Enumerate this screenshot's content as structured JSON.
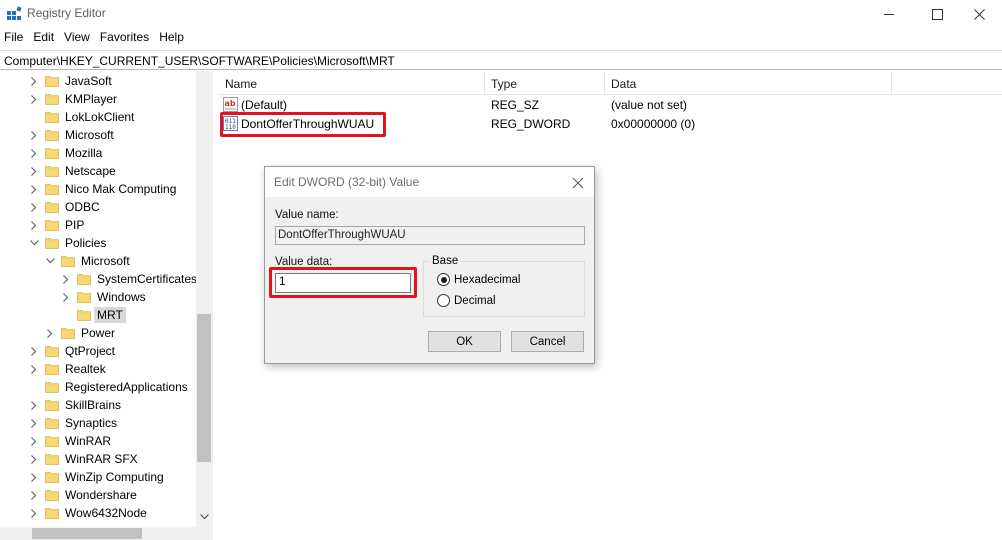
{
  "window": {
    "title": "Registry Editor",
    "icon": "registry-icon"
  },
  "menu": [
    "File",
    "Edit",
    "View",
    "Favorites",
    "Help"
  ],
  "address": "Computer\\HKEY_CURRENT_USER\\SOFTWARE\\Policies\\Microsoft\\MRT",
  "tree": [
    {
      "label": "JavaSoft",
      "expander": "collapsed"
    },
    {
      "label": "KMPlayer",
      "expander": "collapsed"
    },
    {
      "label": "LokLokClient",
      "expander": "none"
    },
    {
      "label": "Microsoft",
      "expander": "collapsed"
    },
    {
      "label": "Mozilla",
      "expander": "collapsed"
    },
    {
      "label": "Netscape",
      "expander": "collapsed"
    },
    {
      "label": "Nico Mak Computing",
      "expander": "collapsed"
    },
    {
      "label": "ODBC",
      "expander": "collapsed"
    },
    {
      "label": "PIP",
      "expander": "collapsed"
    },
    {
      "label": "Policies",
      "expander": "expanded"
    },
    {
      "label": "Microsoft",
      "expander": "expanded"
    },
    {
      "label": "SystemCertificates",
      "expander": "collapsed"
    },
    {
      "label": "Windows",
      "expander": "collapsed"
    },
    {
      "label": "MRT",
      "expander": "none",
      "selected": true
    },
    {
      "label": "Power",
      "expander": "collapsed"
    },
    {
      "label": "QtProject",
      "expander": "collapsed"
    },
    {
      "label": "Realtek",
      "expander": "collapsed"
    },
    {
      "label": "RegisteredApplications",
      "expander": "none"
    },
    {
      "label": "SkillBrains",
      "expander": "collapsed"
    },
    {
      "label": "Synaptics",
      "expander": "collapsed"
    },
    {
      "label": "WinRAR",
      "expander": "collapsed"
    },
    {
      "label": "WinRAR SFX",
      "expander": "collapsed"
    },
    {
      "label": "WinZip Computing",
      "expander": "collapsed"
    },
    {
      "label": "Wondershare",
      "expander": "collapsed"
    },
    {
      "label": "Wow6432Node",
      "expander": "collapsed"
    }
  ],
  "list": {
    "columns": [
      "Name",
      "Type",
      "Data"
    ],
    "rows": [
      {
        "name": "(Default)",
        "type": "REG_SZ",
        "data": "(value not set)",
        "icon": "string-value-icon"
      },
      {
        "name": "DontOfferThroughWUAU",
        "type": "REG_DWORD",
        "data": "0x00000000 (0)",
        "icon": "binary-value-icon",
        "highlighted": true
      }
    ]
  },
  "dialog": {
    "title": "Edit DWORD (32-bit) Value",
    "value_name_label": "Value name:",
    "value_name": "DontOfferThroughWUAU",
    "value_data_label": "Value data:",
    "value_data": "1",
    "base_label": "Base",
    "base_options": [
      {
        "label": "Hexadecimal",
        "selected": true
      },
      {
        "label": "Decimal",
        "selected": false
      }
    ],
    "ok_label": "OK",
    "cancel_label": "Cancel"
  },
  "colors": {
    "highlight": "#e0141d",
    "folder": "#f8d775"
  }
}
